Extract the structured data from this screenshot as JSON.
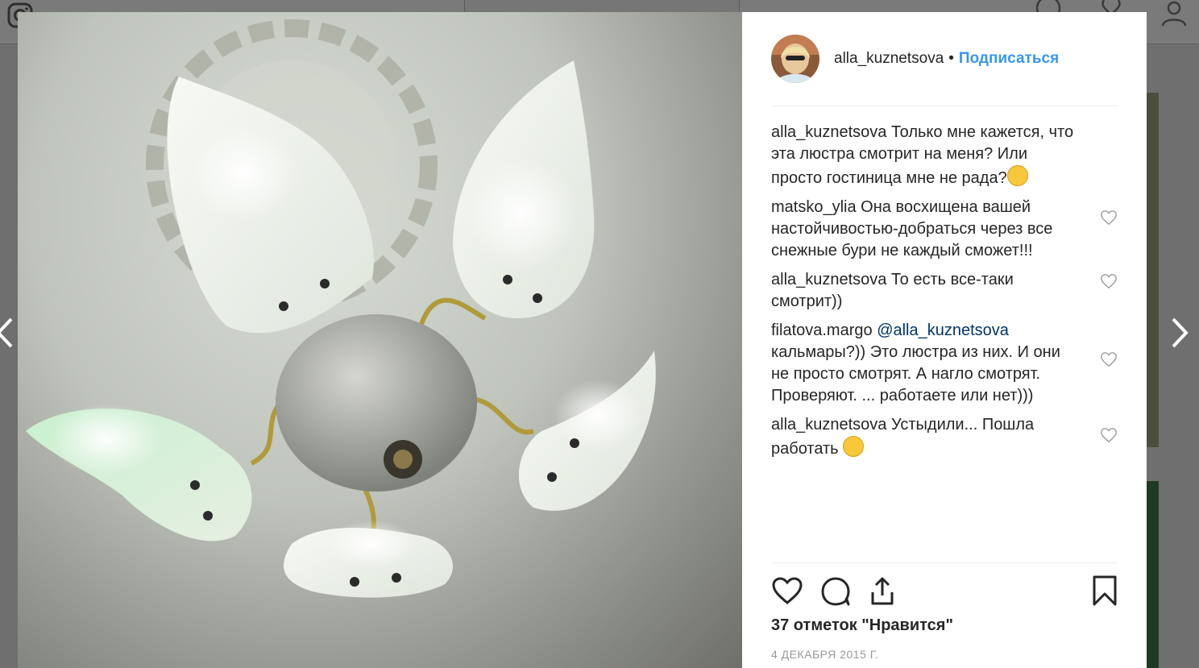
{
  "post": {
    "author": "alla_kuznetsova",
    "separator": "•",
    "follow_label": "Подписаться",
    "caption_user": "alla_kuznetsova",
    "caption_text": "Только мне кажется, что эта люстра смотрит на меня? Или просто гостиница мне не рада?",
    "likes_text": "37 отметок \"Нравится\"",
    "date": "4 ДЕКАБРЯ 2015 Г."
  },
  "comments": [
    {
      "user": "matsko_ylia",
      "text": "Она восхищена вашей настойчивостью-добраться через все снежные бури не каждый сможет!!!"
    },
    {
      "user": "alla_kuznetsova",
      "text": "То есть все-таки смотрит))"
    },
    {
      "user": "filatova.margo",
      "mention": "@alla_kuznetsova",
      "text": "кальмары?)) Это люстра из них. И они не просто смотрят. А нагло смотрят. Проверяют. ... работаете или нет)))"
    },
    {
      "user": "alla_kuznetsova",
      "text": "Устыдили... Пошла работать"
    }
  ],
  "icons": {
    "like": "heart-icon",
    "comment": "comment-bubble-icon",
    "share": "share-icon",
    "save": "bookmark-icon",
    "prev": "chevron-left-icon",
    "next": "chevron-right-icon"
  },
  "colors": {
    "accent": "#3897f0",
    "text": "#262626",
    "mention": "#003569",
    "muted": "#999999"
  }
}
